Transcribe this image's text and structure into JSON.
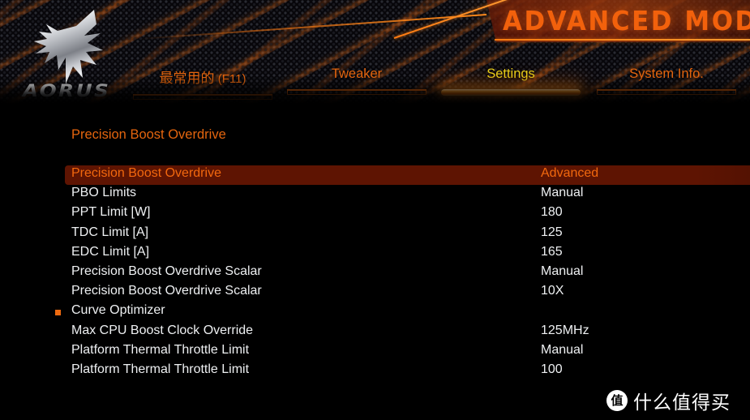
{
  "header": {
    "mode_title": "ADVANCED MODE",
    "brand": "AORUS",
    "logo_icon": "aorus-falcon-icon"
  },
  "tabs": [
    {
      "id": "favorites",
      "label": "最常用的 (F11)",
      "cjk": "最常用的",
      "suffix": " (F11)",
      "active": false
    },
    {
      "id": "tweaker",
      "label": "Tweaker",
      "cjk": "Tweaker",
      "suffix": "",
      "active": false
    },
    {
      "id": "settings",
      "label": "Settings",
      "cjk": "Settings",
      "suffix": "",
      "active": true
    },
    {
      "id": "system-info",
      "label": "System Info.",
      "cjk": "System Info.",
      "suffix": "",
      "active": false
    }
  ],
  "main": {
    "section_title": "Precision Boost Overdrive",
    "rows": [
      {
        "label": "Precision Boost Overdrive",
        "value": "Advanced",
        "selected": true,
        "bullet": false
      },
      {
        "label": "PBO Limits",
        "value": "Manual",
        "selected": false,
        "bullet": false
      },
      {
        "label": "PPT Limit [W]",
        "value": "180",
        "selected": false,
        "bullet": false
      },
      {
        "label": "TDC Limit [A]",
        "value": "125",
        "selected": false,
        "bullet": false
      },
      {
        "label": "EDC Limit [A]",
        "value": "165",
        "selected": false,
        "bullet": false
      },
      {
        "label": "Precision Boost Overdrive Scalar",
        "value": "Manual",
        "selected": false,
        "bullet": false
      },
      {
        "label": "Precision Boost Overdrive Scalar",
        "value": "10X",
        "selected": false,
        "bullet": false
      },
      {
        "label": "Curve Optimizer",
        "value": "",
        "selected": false,
        "bullet": true
      },
      {
        "label": "Max CPU Boost Clock Override",
        "value": "125MHz",
        "selected": false,
        "bullet": false
      },
      {
        "label": "Platform Thermal Throttle Limit",
        "value": "Manual",
        "selected": false,
        "bullet": false
      },
      {
        "label": "Platform Thermal Throttle Limit",
        "value": "100",
        "selected": false,
        "bullet": false
      }
    ]
  },
  "watermark": {
    "badge": "值",
    "text": "什么值得买"
  },
  "colors": {
    "accent_orange": "#e4650e",
    "active_tab_yellow": "#e8d21a",
    "selected_row_bg": "#5e1402",
    "selected_row_text": "#f2680e",
    "row_text": "#eef0f2",
    "background": "#000000"
  }
}
